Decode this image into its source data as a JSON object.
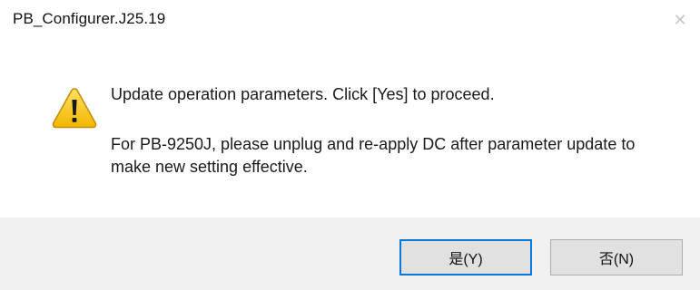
{
  "window": {
    "title": "PB_Configurer.J25.19",
    "close_glyph": "✕"
  },
  "message": {
    "icon": "warning-icon",
    "main": "Update operation parameters. Click [Yes] to proceed.",
    "detail": "For PB-9250J, please unplug and re-apply DC after parameter update to make new setting effective."
  },
  "buttons": {
    "yes_label": "是(Y)",
    "no_label": "否(N)"
  },
  "colors": {
    "warning_fill": "#f5c400",
    "warning_outline": "#c58b00",
    "focus_border": "#0078d7",
    "footer_bg": "#f0f0f0"
  }
}
